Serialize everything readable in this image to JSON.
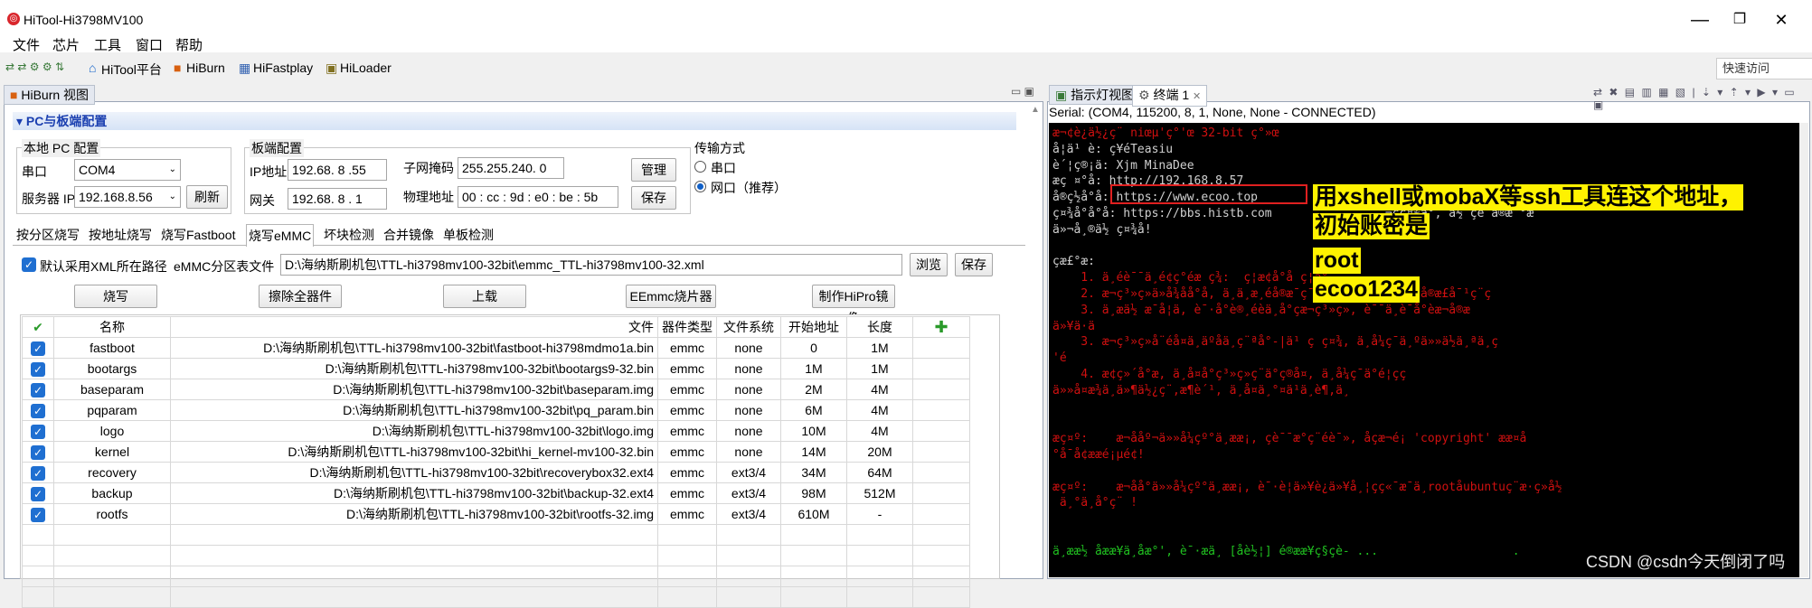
{
  "window": {
    "title": "HiTool-Hi3798MV100",
    "min": "—",
    "max": "❐",
    "close": "✕"
  },
  "menu": [
    "文件",
    "芯片",
    "工具",
    "窗口",
    "帮助"
  ],
  "toolbar": {
    "items": [
      "HiTool平台",
      "HiBurn",
      "HiFastplay",
      "HiLoader"
    ],
    "quick_access": "快速访问"
  },
  "left": {
    "view_tab": "HiBurn 视图",
    "section": "PC与板端配置",
    "pc": {
      "title": "本地 PC 配置",
      "port_label": "串口",
      "port_value": "COM4",
      "server_label": "服务器 IP",
      "server_value": "192.168.8.56",
      "refresh": "刷新"
    },
    "board": {
      "title": "板端配置",
      "ip_label": "IP地址",
      "ip_value": "192.68. 8 .55",
      "gw_label": "网关",
      "gw_value": "192.68. 8 . 1",
      "mask_label": "子网掩码",
      "mask_value": "255.255.240. 0",
      "mac_label": "物理地址",
      "mac_value": "00 : cc : 9d : e0 : be : 5b",
      "manage": "管理",
      "save": "保存"
    },
    "transfer": {
      "title": "传输方式",
      "opt1": "串口",
      "opt2": "网口（推荐）"
    },
    "tabs": [
      "按分区烧写",
      "按地址烧写",
      "烧写Fastboot",
      "烧写eMMC",
      "坏块检测",
      "合并镜像",
      "单板检测"
    ],
    "xml": {
      "checkbox_label": "默认采用XML所在路径",
      "file_label": "eMMC分区表文件",
      "path": "D:\\海纳斯刷机包\\TTL-hi3798mv100-32bit\\emmc_TTL-hi3798mv100-32.xml",
      "browse": "浏览",
      "save": "保存"
    },
    "actions": [
      "烧写",
      "擦除全器件",
      "上载",
      "EEmmc烧片器镜",
      "制作HiPro镜像"
    ],
    "columns": [
      "名称",
      "文件",
      "器件类型",
      "文件系统",
      "开始地址",
      "长度"
    ],
    "rows": [
      [
        "fastboot",
        "D:\\海纳斯刷机包\\TTL-hi3798mv100-32bit\\fastboot-hi3798mdmo1a.bin",
        "emmc",
        "none",
        "0",
        "1M"
      ],
      [
        "bootargs",
        "D:\\海纳斯刷机包\\TTL-hi3798mv100-32bit\\bootargs9-32.bin",
        "emmc",
        "none",
        "1M",
        "1M"
      ],
      [
        "baseparam",
        "D:\\海纳斯刷机包\\TTL-hi3798mv100-32bit\\baseparam.img",
        "emmc",
        "none",
        "2M",
        "4M"
      ],
      [
        "pqparam",
        "D:\\海纳斯刷机包\\TTL-hi3798mv100-32bit\\pq_param.bin",
        "emmc",
        "none",
        "6M",
        "4M"
      ],
      [
        "logo",
        "D:\\海纳斯刷机包\\TTL-hi3798mv100-32bit\\logo.img",
        "emmc",
        "none",
        "10M",
        "4M"
      ],
      [
        "kernel",
        "D:\\海纳斯刷机包\\TTL-hi3798mv100-32bit\\hi_kernel-mv100-32.bin",
        "emmc",
        "none",
        "14M",
        "20M"
      ],
      [
        "recovery",
        "D:\\海纳斯刷机包\\TTL-hi3798mv100-32bit\\recoverybox32.ext4",
        "emmc",
        "ext3/4",
        "34M",
        "64M"
      ],
      [
        "backup",
        "D:\\海纳斯刷机包\\TTL-hi3798mv100-32bit\\backup-32.ext4",
        "emmc",
        "ext3/4",
        "98M",
        "512M"
      ],
      [
        "rootfs",
        "D:\\海纳斯刷机包\\TTL-hi3798mv100-32bit\\rootfs-32.img",
        "emmc",
        "ext3/4",
        "610M",
        "-"
      ]
    ]
  },
  "right": {
    "tabs": [
      "指示灯视图",
      "终端 1"
    ],
    "status": "Serial: (COM4, 115200, 8, 1, None, None - CONNECTED)",
    "terminal": [
      {
        "text": "æ¬¢è¿ä½¿ç¨ niœµ'ç°'œ 32-bit ç°»œ",
        "color": "#d01010"
      },
      {
        "text": "å­¦ä¹ è: ç¥éTeasiu",
        "color": "#d0d0d0"
      },
      {
        "text": "è´¦ç®¡ä: Xjm MinaDee",
        "color": "#d0d0d0"
      },
      {
        "text": "æç ¤°å: http://192.168.8.57",
        "color": "#d0d0d0"
      },
      {
        "text": "å®ç½å°å: https://www.ecoo.top",
        "color": "#d0d0d0"
      },
      {
        "text": "ç¤¾å°å°å: https://bbs.histb.com                ¬çç¤¾å°, ä½ çè¯å®æ¯°æ",
        "color": "#d0d0d0"
      },
      {
        "text": "ä»¬å¸®ä½ ç¤¾å!",
        "color": "#d0d0d0"
      },
      {
        "text": "",
        "color": "#d0d0d0"
      },
      {
        "text": "çæ£°æ:",
        "color": "#d0d0d0"
      },
      {
        "text": "    1. ä¸éè¯¯ä¸é¢ç°éæ ç­¾:  ç¦æ¢å°å ç¦å°",
        "color": "#d01010"
      },
      {
        "text": "    2. æ¬ç³»ç»ä»å¾åå°å, ä¸ä¸æ¸éå®æ¯ç¯ç å·²ç¨äº, è¶å¨å®æ£å¯¹ç¨ç",
        "color": "#d01010"
      },
      {
        "text": "    3. ä¸æä½ æ¯å¦ä, è¯·å°è®¸éèä¸å°çæ¬ç³»ç», è¯¯ä¸è¯å°èæ¬å®æ",
        "color": "#d01010"
      },
      {
        "text": "ä»¥ä·ä",
        "color": "#d01010"
      },
      {
        "text": "    3. æ¬ç³»ç»å¨éå¤ä¸äºåä¸ç¨ªå°-|ä¹ ç ç¤¾, ä¸å¼ç¯ä¸ºä»»ä½ä¸ªä¸ç",
        "color": "#d01010"
      },
      {
        "text": "'é",
        "color": "#d01010"
      },
      {
        "text": "    4. æ¢ç»´å°æ, ä¸å¤å°ç³»ç»ç¨ä°ç®å¤, ä¸å¼ç¯ä°é¦çç",
        "color": "#d01010"
      },
      {
        "text": "ä»»å¤æ¾ä¸ä»¶ä½¿ç¨,æ¶è´¹, ä¸å¤ä¸°¤ä¹ä¸è¶,ä¸",
        "color": "#d01010"
      },
      {
        "text": "",
        "color": "#d0d0d0"
      },
      {
        "text": "",
        "color": "#d0d0d0"
      },
      {
        "text": "æç¤º:    æ¬ååº¬ä»»å¼çº°ä¸ææ¡, çè¯¯æ°ç¨éè¯», åçæ¬é¡ 'copyright' ææ¤å",
        "color": "#d01010"
      },
      {
        "text": "°å¯å¢ææé¡µé¢!",
        "color": "#d01010"
      },
      {
        "text": "",
        "color": "#d0d0d0"
      },
      {
        "text": "æç¤º:    æ¬åå°ä»»å¼çº°ä¸ææ¡, è¯·è¦ä»¥è¿ä»¥å¸¦çç«¯æ¯ä¸rootåubuntuç¨æ·ç»å½",
        "color": "#d01010"
      },
      {
        "text": " ä¸°ä¸å°ç¨ !",
        "color": "#d01010"
      },
      {
        "text": "",
        "color": "#d0d0d0"
      },
      {
        "text": "",
        "color": "#d0d0d0"
      },
      {
        "text": "ä¸ææ½ åææ¥ä¸åæ°', è¯·æä¸ [åè½¦] é®ææ¥ç§çè- ...                   .",
        "color": "#20c020"
      }
    ],
    "annotations": [
      "用xshell或mobaX等ssh工具连这个地址，",
      "初始账密是",
      "root",
      "ecoo1234"
    ],
    "watermark": "CSDN @csdn今天倒闭了吗"
  }
}
